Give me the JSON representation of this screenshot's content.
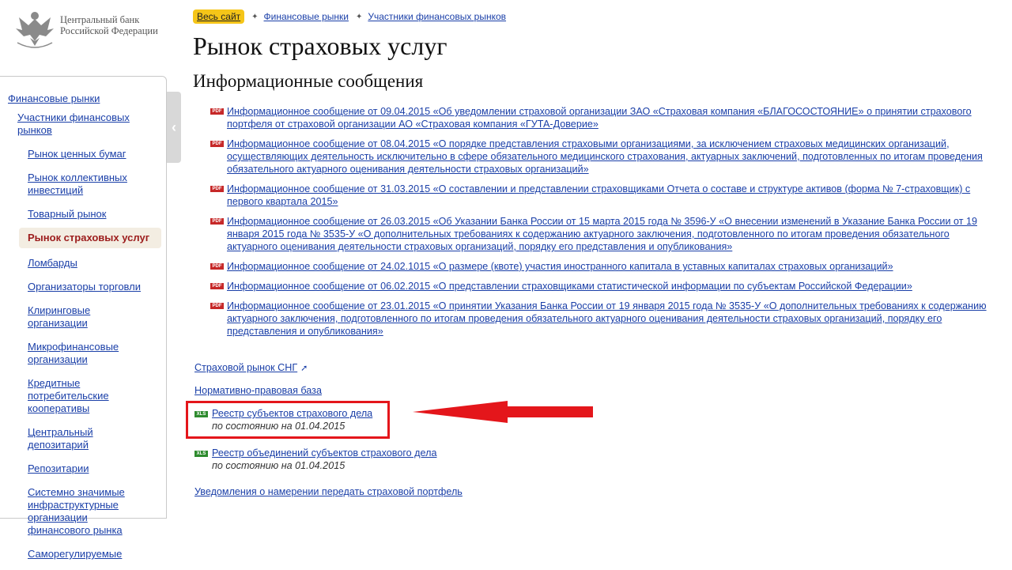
{
  "logo": {
    "line1": "Центральный банк",
    "line2": "Российской Федерации"
  },
  "breadcrumb": {
    "home": "Весь сайт",
    "items": [
      "Финансовые рынки",
      "Участники финансовых рынков"
    ]
  },
  "page": {
    "title": "Рынок страховых услуг",
    "section_title": "Информационные сообщения"
  },
  "sidebar": {
    "root": "Финансовые рынки",
    "parent": "Участники финансовых рынков",
    "items": [
      {
        "label": "Рынок ценных бумаг"
      },
      {
        "label": "Рынок коллективных инвестиций"
      },
      {
        "label": "Товарный рынок"
      },
      {
        "label": "Рынок страховых услуг",
        "active": true
      },
      {
        "label": "Ломбарды"
      },
      {
        "label": "Организаторы торговли"
      },
      {
        "label": "Клиринговые организации"
      },
      {
        "label": "Микрофинансовые организации"
      },
      {
        "label": "Кредитные потребительские кооперативы"
      },
      {
        "label": "Центральный депозитарий"
      },
      {
        "label": "Репозитарии"
      },
      {
        "label": "Системно значимые инфраструктурные организации финансового рынка"
      },
      {
        "label": "Саморегулируемые"
      }
    ],
    "toggle_icon": "chevron-left-icon"
  },
  "messages": [
    "Информационное сообщение от 09.04.2015 «Об уведомлении страховой организации ЗАО «Страховая компания «БЛАГОСОСТОЯНИЕ» о принятии страхового портфеля от страховой организации АО «Страховая компания «ГУТА-Доверие»",
    "Информационное сообщение от 08.04.2015 «О порядке представления страховыми организациями, за исключением страховых медицинских организаций, осуществляющих деятельность исключительно в сфере обязательного медицинского страхования, актуарных заключений, подготовленных по итогам проведения обязательного актуарного оценивания деятельности страховых организаций»",
    "Информационное сообщение от 31.03.2015 «О составлении и представлении страховщиками Отчета о составе и структуре активов (форма № 7-страховщик) с первого квартала 2015»",
    "Информационное сообщение от 26.03.2015 «Об Указании Банка России от 15 марта 2015 года № 3596-У «О внесении изменений в Указание Банка России от 19 января 2015 года № 3535-У «О дополнительных требованиях к содержанию актуарного заключения, подготовленного по итогам проведения обязательного актуарного оценивания деятельности страховых организаций, порядку его представления и опубликования»",
    "Информационное сообщение от 24.02.1015 «О размере (квоте) участия иностранного капитала в уставных капиталах страховых организаций»",
    "Информационное сообщение от 06.02.2015 «О представлении страховщиками статистической информации по субъектам Российской Федерации»",
    "Информационное сообщение от 23.01.2015 «О принятии Указания Банка России от 19 января 2015 года № 3535-У «О дополнительных требованиях к содержанию актуарного заключения, подготовленного по итогам проведения обязательного актуарного оценивания деятельности страховых организаций, порядку его представления и опубликования»"
  ],
  "pdf_label": "PDF",
  "xls_label": "XLS",
  "links": {
    "cis_market": "Страховой рынок СНГ",
    "regulatory_base": "Нормативно-правовая база",
    "notice_transfer": "Уведомления о намерении передать страховой портфель"
  },
  "registries": [
    {
      "title": "Реестр субъектов страхового дела",
      "date": "по состоянию на 01.04.2015"
    },
    {
      "title": "Реестр объединений субъектов страхового дела",
      "date": "по состоянию на 01.04.2015"
    }
  ],
  "colors": {
    "link": "#1a3fa8",
    "active_nav": "#9c1c1c",
    "home_button": "#f5c518",
    "highlight": "#e4161b"
  }
}
